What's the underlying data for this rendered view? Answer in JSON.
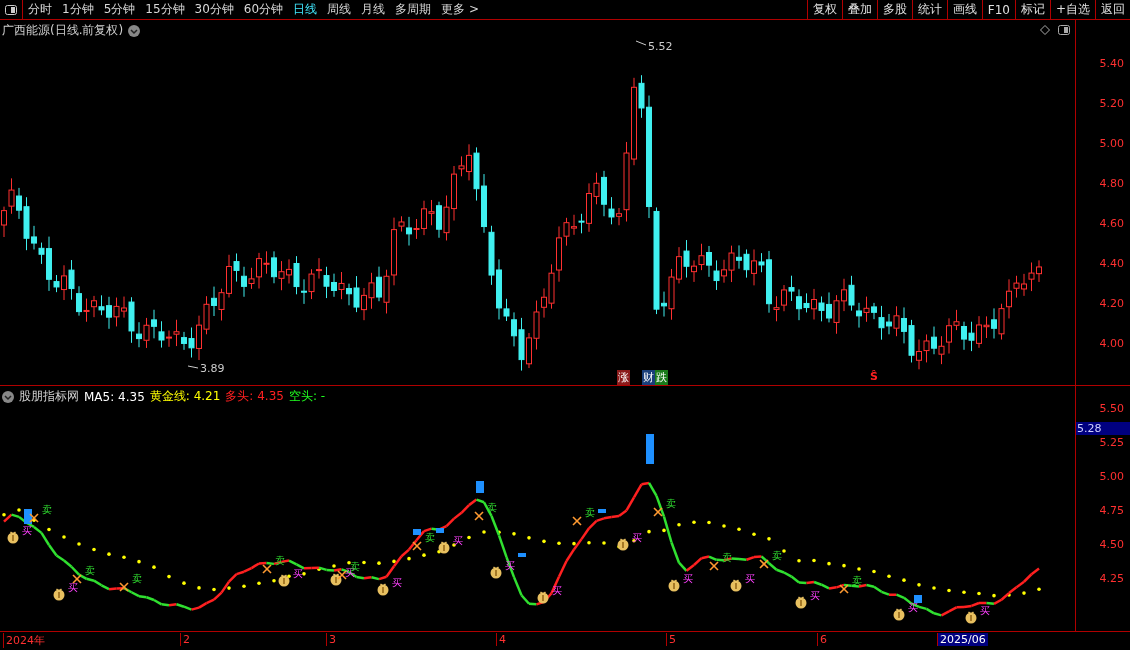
{
  "toolbar": {
    "periods": [
      {
        "label": "分时",
        "selected": false
      },
      {
        "label": "1分钟",
        "selected": false
      },
      {
        "label": "5分钟",
        "selected": false
      },
      {
        "label": "15分钟",
        "selected": false
      },
      {
        "label": "30分钟",
        "selected": false
      },
      {
        "label": "60分钟",
        "selected": false
      },
      {
        "label": "日线",
        "selected": true
      },
      {
        "label": "周线",
        "selected": false
      },
      {
        "label": "月线",
        "selected": false
      },
      {
        "label": "多周期",
        "selected": false
      },
      {
        "label": "更多 >",
        "selected": false
      }
    ],
    "buttons": [
      "复权",
      "叠加",
      "多股",
      "统计",
      "画线",
      "F10",
      "标记",
      "+自选",
      "返回"
    ]
  },
  "price_panel": {
    "title": "广西能源(日线.前复权)",
    "high_label": "5.52",
    "low_label": "3.89",
    "axis_ticks": [
      "5.40",
      "5.20",
      "5.00",
      "4.80",
      "4.60",
      "4.40",
      "4.20",
      "4.00"
    ],
    "events": [
      {
        "text": "涨",
        "color": "#8b1a1a"
      },
      {
        "text": "财",
        "color": "#1a3f7a"
      },
      {
        "text": "跌",
        "color": "#1a7a1a"
      },
      {
        "text": "Ŝ",
        "color": "#ff2020"
      }
    ]
  },
  "indicator_panel": {
    "name": "股朋指标网",
    "legend": [
      {
        "text": "MA5: 4.35",
        "kind": "ma"
      },
      {
        "text": "黄金线: 4.21",
        "kind": "golden"
      },
      {
        "text": "多头: 4.35",
        "kind": "long"
      },
      {
        "text": "空头: -",
        "kind": "short"
      }
    ],
    "axis_ticks": [
      "5.50",
      "5.25",
      "5.00",
      "4.75",
      "4.50",
      "4.25"
    ],
    "cursor_value": "5.28",
    "signals": [
      {
        "kind": "buy",
        "text": "买"
      },
      {
        "kind": "sell",
        "text": "卖"
      },
      {
        "kind": "buy",
        "text": "买"
      },
      {
        "kind": "sell",
        "text": "卖"
      },
      {
        "kind": "sell",
        "text": "卖"
      },
      {
        "kind": "sell",
        "text": "卖"
      },
      {
        "kind": "buy",
        "text": "买"
      },
      {
        "kind": "buy",
        "text": "买"
      },
      {
        "kind": "sell",
        "text": "卖"
      },
      {
        "kind": "buy",
        "text": "买"
      },
      {
        "kind": "sell",
        "text": "卖"
      },
      {
        "kind": "buy",
        "text": "买"
      },
      {
        "kind": "sell",
        "text": "卖"
      },
      {
        "kind": "buy",
        "text": "买"
      },
      {
        "kind": "buy",
        "text": "买"
      },
      {
        "kind": "sell",
        "text": "卖"
      },
      {
        "kind": "buy",
        "text": "买"
      },
      {
        "kind": "sell",
        "text": "卖"
      },
      {
        "kind": "buy",
        "text": "买"
      },
      {
        "kind": "sell",
        "text": "卖"
      },
      {
        "kind": "buy",
        "text": "买"
      },
      {
        "kind": "sell",
        "text": "卖"
      },
      {
        "kind": "buy",
        "text": "买"
      },
      {
        "kind": "sell",
        "text": "卖"
      },
      {
        "kind": "buy",
        "text": "买"
      },
      {
        "kind": "buy",
        "text": "买"
      }
    ]
  },
  "date_axis": [
    {
      "label": "2024年",
      "selected": false
    },
    {
      "label": "2",
      "selected": false
    },
    {
      "label": "3",
      "selected": false
    },
    {
      "label": "4",
      "selected": false
    },
    {
      "label": "5",
      "selected": false
    },
    {
      "label": "6",
      "selected": false
    },
    {
      "label": "2025/06",
      "selected": true
    }
  ]
}
